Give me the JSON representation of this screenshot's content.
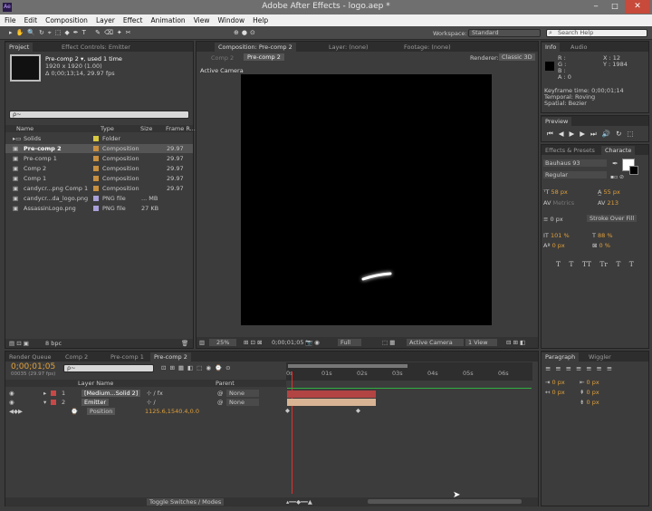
{
  "app": {
    "title": "Adobe After Effects - logo.aep *",
    "icon": "Ae"
  },
  "menu": [
    "File",
    "Edit",
    "Composition",
    "Layer",
    "Effect",
    "Animation",
    "View",
    "Window",
    "Help"
  ],
  "toolbar": {
    "workspace_label": "Workspace:",
    "workspace_value": "Standard",
    "search_placeholder": "Search Help"
  },
  "project": {
    "tab": "Project",
    "tab2": "Effect Controls: Emitter",
    "item_name": "Pre-comp 2 ▾, used 1 time",
    "item_dims": "1920 x 1920 (1.00)",
    "item_dur": "Δ 0;00;13;14, 29.97 fps",
    "search": "ρ~",
    "columns": [
      "Name",
      "Type",
      "Size",
      "Frame R..."
    ],
    "rows": [
      {
        "name": "Solids",
        "type": "Folder",
        "size": "",
        "fps": "",
        "color": "#d8c840"
      },
      {
        "name": "Pre-comp 2",
        "type": "Composition",
        "size": "",
        "fps": "29.97",
        "color": "#c89040"
      },
      {
        "name": "Pre-comp 1",
        "type": "Composition",
        "size": "",
        "fps": "29.97",
        "color": "#c89040"
      },
      {
        "name": "Comp 2",
        "type": "Composition",
        "size": "",
        "fps": "29.97",
        "color": "#c89040"
      },
      {
        "name": "Comp 1",
        "type": "Composition",
        "size": "",
        "fps": "29.97",
        "color": "#c89040"
      },
      {
        "name": "candycr...png Comp 1",
        "type": "Composition",
        "size": "",
        "fps": "29.97",
        "color": "#c89040"
      },
      {
        "name": "candycr...da_logo.png",
        "type": "PNG file",
        "size": "... MB",
        "fps": "",
        "color": "#a8a0d8"
      },
      {
        "name": "AssassinLogo.png",
        "type": "PNG file",
        "size": "27 KB",
        "fps": "",
        "color": "#a8a0d8"
      }
    ],
    "bpc": "8 bpc"
  },
  "comp": {
    "tab": "Composition: Pre-comp 2",
    "tab2": "Layer: (none)",
    "tab3": "Footage: (none)",
    "crumb1": "Comp 2",
    "crumb2": "Pre-comp 2",
    "renderer_label": "Renderer:",
    "renderer": "Classic 3D",
    "active_camera": "Active Camera",
    "zoom": "25%",
    "timecode": "0;00;01;05",
    "quality": "Full",
    "view": "Active Camera",
    "views": "1 View"
  },
  "info": {
    "tab": "Info",
    "tab2": "Audio",
    "r": "R :",
    "g": "G :",
    "b": "B :",
    "a": "A : 0",
    "x": "X : 12",
    "y": "Y : 1984",
    "kf_time": "Keyframe time: 0;00;01;14",
    "temporal": "Temporal: Roving",
    "spatial": "Spatial: Bezier"
  },
  "preview": {
    "tab": "Preview"
  },
  "character": {
    "tab1": "Effects & Presets",
    "tab2": "Characte",
    "font": "Bauhaus 93",
    "style": "Regular",
    "size": "58 px",
    "leading": "55 px",
    "tracking_label": "Metrics",
    "tracking": "213",
    "stroke": "0 px",
    "stroke_mode": "Stroke Over Fill",
    "vscale": "101 %",
    "hscale": "88 %",
    "baseline": "0 px",
    "tsume": "0 %",
    "styles": [
      "T",
      "T",
      "TT",
      "Tr",
      "T",
      "T"
    ]
  },
  "paragraph": {
    "tab": "Paragraph",
    "tab2": "Wiggler",
    "values": [
      "0 px",
      "0 px",
      "0 px",
      "0 px",
      "0 px"
    ]
  },
  "timeline": {
    "tabs": [
      "Render Queue",
      "Comp 2",
      "Pre-comp 1",
      "Pre-comp 2"
    ],
    "timecode": "0;00;01;05",
    "frames": "00035 (29.97 fps)",
    "search": "ρ~",
    "col_layer": "Layer Name",
    "col_parent": "Parent",
    "layers": [
      {
        "num": "1",
        "name": "[Medium...Solid 2]",
        "parent": "None",
        "color": "#c84848"
      },
      {
        "num": "2",
        "name": "Emitter",
        "parent": "None",
        "color": "#c84848"
      }
    ],
    "prop": "Position",
    "prop_val": "1125.6,1540.4,0.0",
    "ticks": [
      "0s",
      "01s",
      "02s",
      "03s",
      "04s",
      "05s",
      "06s"
    ],
    "toggle": "Toggle Switches / Modes"
  }
}
